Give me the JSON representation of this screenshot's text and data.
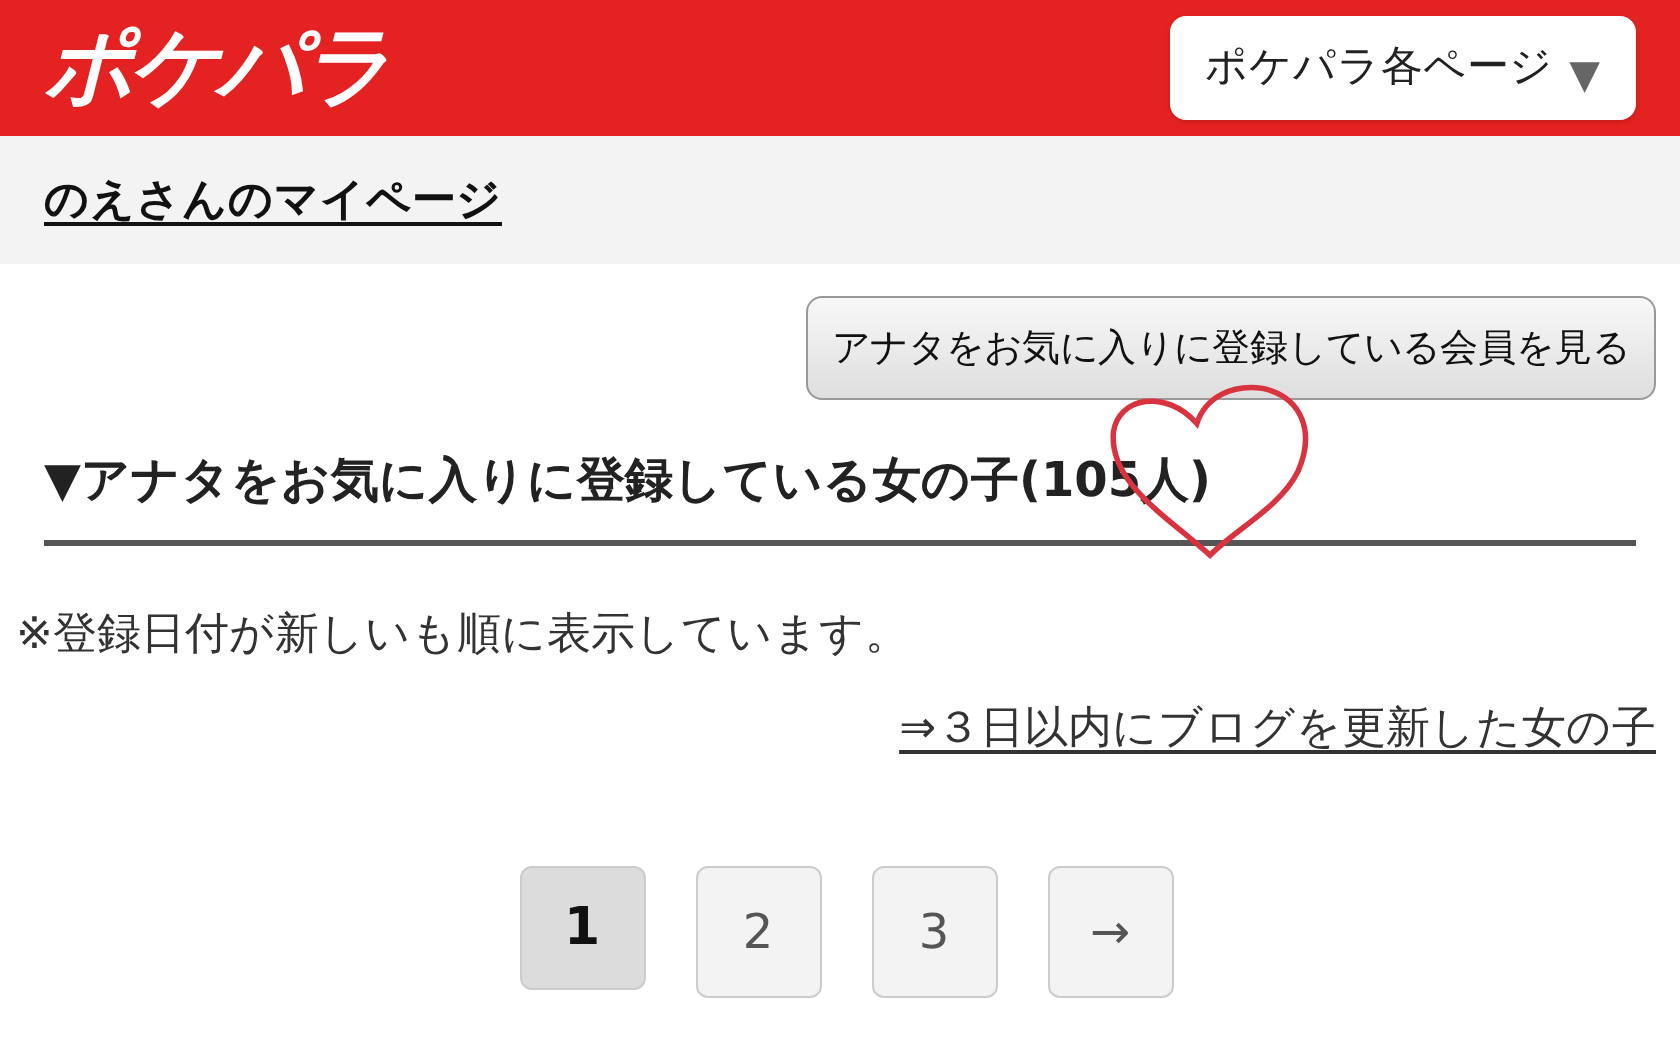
{
  "header": {
    "logo": "ポケパラ",
    "menu_button": "ポケパラ各ページ",
    "menu_caret": "▼"
  },
  "breadcrumb": "のえさんのマイページ",
  "action_button": "アナタをお気に入りに登録している会員を見る",
  "section": {
    "title": "▼アナタをお気に入りに登録している女の子",
    "count": "(105人)"
  },
  "note": "※登録日付が新しいも順に表示しています。",
  "filter_link": "⇒３日以内にブログを更新した女の子",
  "pagination": [
    {
      "label": "1",
      "selected": true
    },
    {
      "label": "2",
      "selected": false
    },
    {
      "label": "3",
      "selected": false
    },
    {
      "label": "→",
      "selected": false
    }
  ]
}
